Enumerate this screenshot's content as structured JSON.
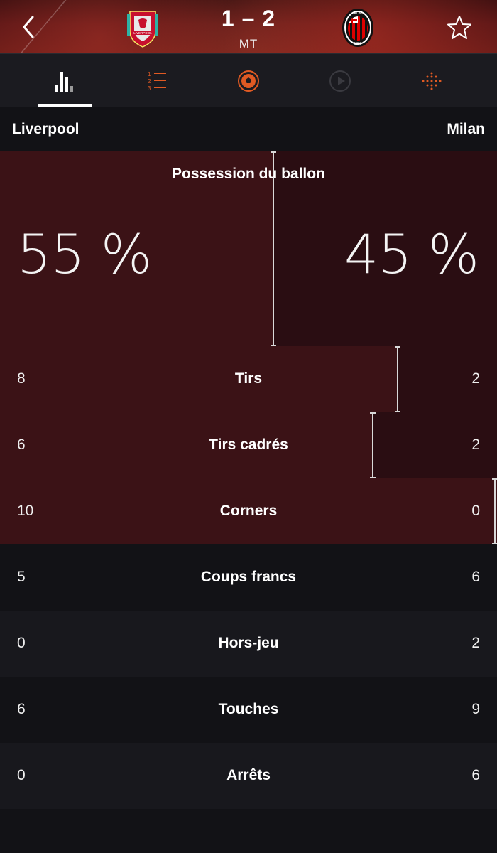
{
  "header": {
    "score": "1 – 2",
    "status": "MT",
    "home_crest": "liverpool-crest",
    "away_crest": "ac-milan-crest",
    "crest_text": {
      "home": "LIVERPOOL",
      "away_top": "ACM",
      "away_year": "1899"
    }
  },
  "tabs": [
    {
      "icon": "bar-chart-icon",
      "active": true
    },
    {
      "icon": "numbered-list-icon",
      "active": false
    },
    {
      "icon": "ball-icon",
      "active": false
    },
    {
      "icon": "play-icon",
      "active": false
    },
    {
      "icon": "pitch-dots-icon",
      "active": false
    }
  ],
  "teams": {
    "home": "Liverpool",
    "away": "Milan"
  },
  "possession": {
    "label": "Possession du ballon",
    "home_text": "55 %",
    "away_text": "45 %",
    "home_pct": 55,
    "away_pct": 45
  },
  "stats": [
    {
      "label": "Tirs",
      "home": "8",
      "away": "2"
    },
    {
      "label": "Tirs cadrés",
      "home": "6",
      "away": "2"
    },
    {
      "label": "Corners",
      "home": "10",
      "away": "0"
    },
    {
      "label": "Coups francs",
      "home": "5",
      "away": "6"
    },
    {
      "label": "Hors-jeu",
      "home": "0",
      "away": "2"
    },
    {
      "label": "Touches",
      "home": "6",
      "away": "9"
    },
    {
      "label": "Arrêts",
      "home": "0",
      "away": "6"
    }
  ],
  "colors": {
    "accent": "#e05a23",
    "home_bar": "#3b1216",
    "away_bar": "#2a0d12",
    "background": "#121216"
  }
}
